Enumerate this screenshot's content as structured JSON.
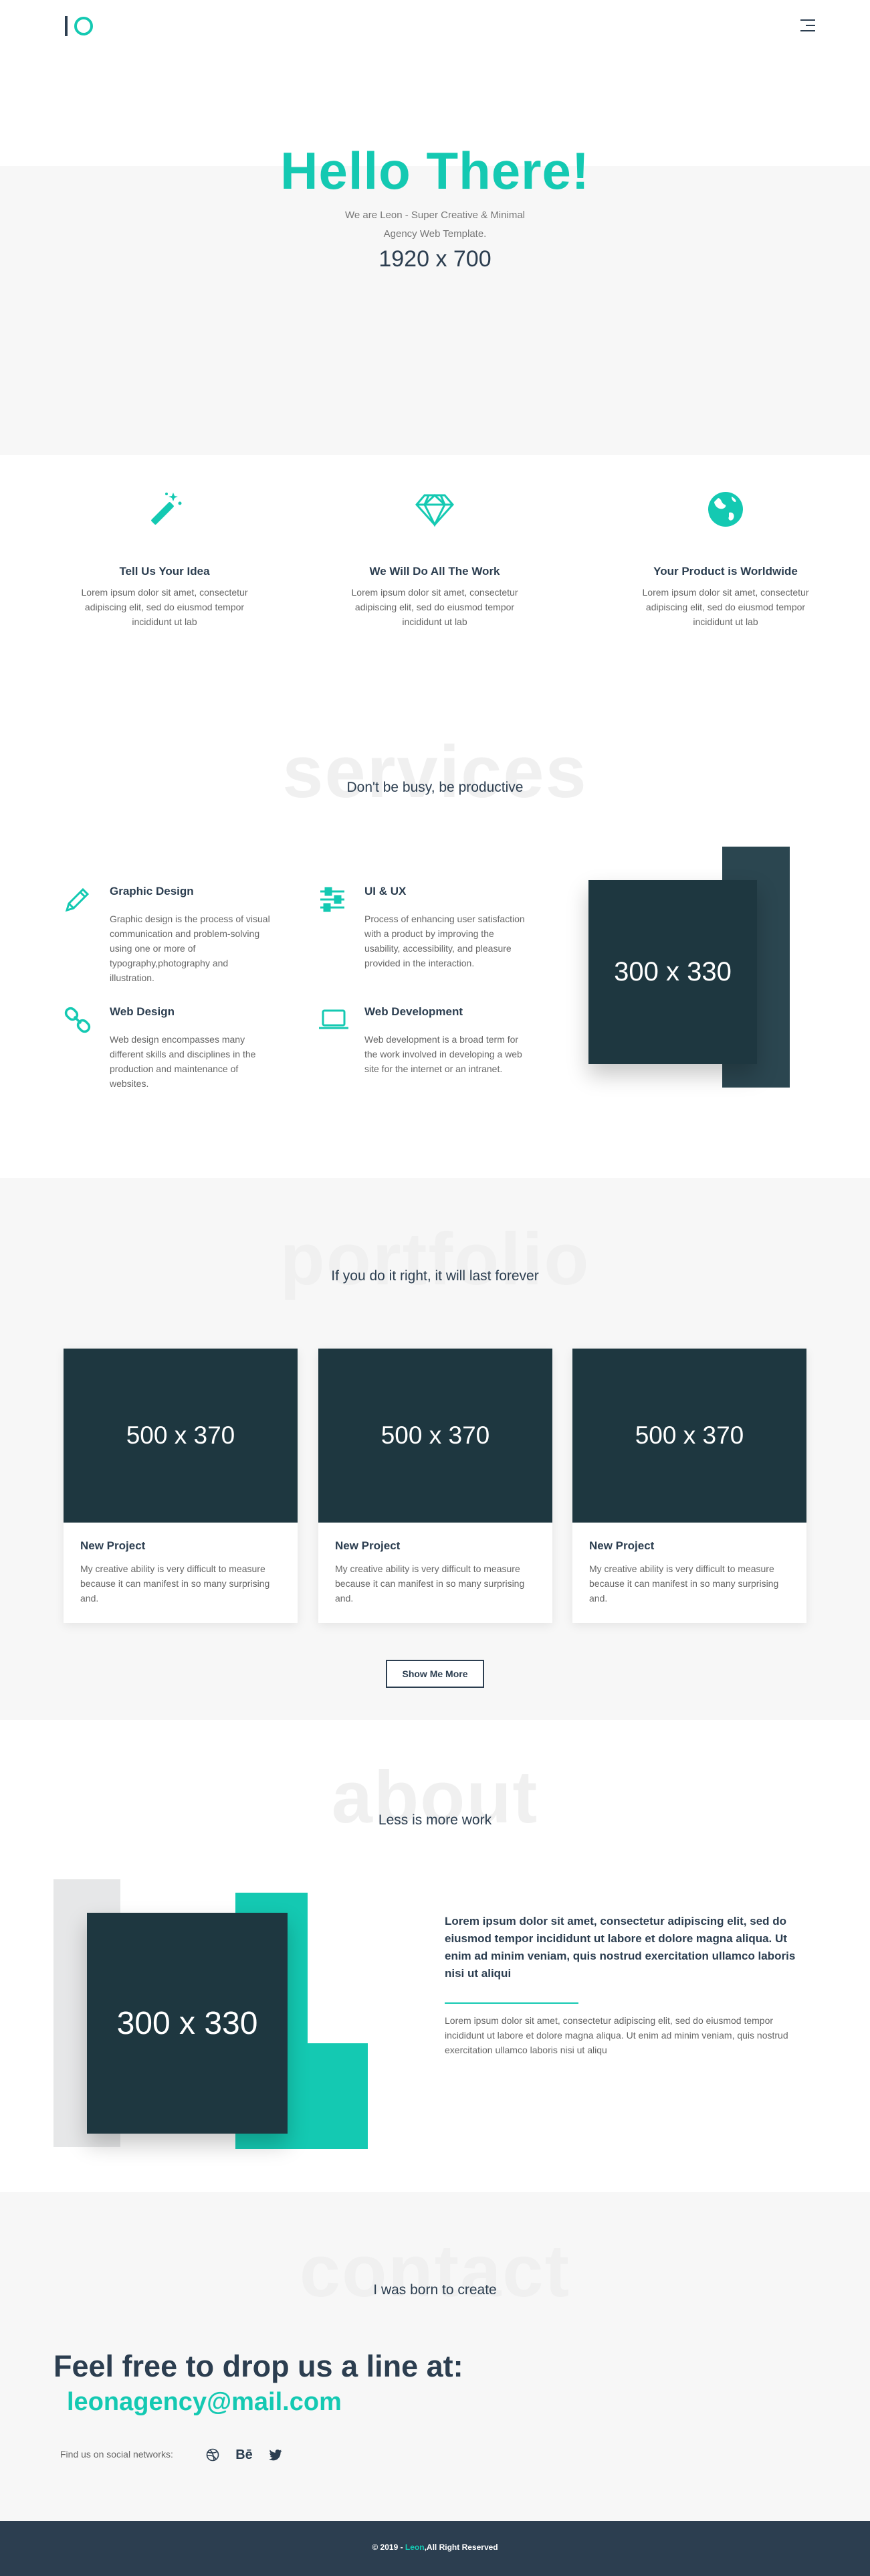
{
  "colors": {
    "accent": "#14c9b2",
    "dark": "#2c3e50",
    "placeholder": "#1e3740",
    "light_bg": "#f7f7f7"
  },
  "header": {
    "logo_icon": "logo-mark",
    "menu_icon": "hamburger-menu-icon"
  },
  "hero": {
    "title": "Hello There!",
    "subtitle_line1": "We are Leon - Super Creative & Minimal",
    "subtitle_line2": "Agency Web Template.",
    "size_label": "1920 x 700"
  },
  "features": [
    {
      "icon": "magic-wand-icon",
      "title": "Tell Us Your Idea",
      "text": "Lorem ipsum dolor sit amet, consectetur adipiscing elit, sed do eiusmod tempor incididunt ut lab"
    },
    {
      "icon": "diamond-icon",
      "title": "We Will Do All The Work",
      "text": "Lorem ipsum dolor sit amet, consectetur adipiscing elit, sed do eiusmod tempor incididunt ut lab"
    },
    {
      "icon": "globe-icon",
      "title": "Your Product is Worldwide",
      "text": "Lorem ipsum dolor sit amet, consectetur adipiscing elit, sed do eiusmod tempor incididunt ut lab"
    }
  ],
  "services": {
    "bg_title": "services",
    "subtitle": "Don't be busy, be productive",
    "items": [
      {
        "icon": "pencil-icon",
        "title": "Graphic Design",
        "text": "Graphic design is the process of visual communication and problem-solving using one or more of typography,photography and illustration."
      },
      {
        "icon": "sliders-icon",
        "title": "UI & UX",
        "text": "Process of enhancing user satisfaction with a product by improving the usability, accessibility, and pleasure provided in the interaction."
      },
      {
        "icon": "link-icon",
        "title": "Web Design",
        "text": "Web design encompasses many different skills and disciplines in the production and maintenance of websites."
      },
      {
        "icon": "laptop-icon",
        "title": "Web Development",
        "text": "Web development is a broad term for the work involved in developing a web site for the internet or an intranet."
      }
    ],
    "image_label": "300 x 330"
  },
  "portfolio": {
    "bg_title": "portfolio",
    "subtitle": "If you do it right, it will last forever",
    "projects": [
      {
        "image_label": "500 x 370",
        "title": "New Project",
        "text": "My creative ability is very difficult to measure because it can manifest in so many surprising and."
      },
      {
        "image_label": "500 x 370",
        "title": "New Project",
        "text": "My creative ability is very difficult to measure because it can manifest in so many surprising and."
      },
      {
        "image_label": "500 x 370",
        "title": "New Project",
        "text": "My creative ability is very difficult to measure because it can manifest in so many surprising and."
      }
    ],
    "show_more": "Show Me More"
  },
  "about": {
    "bg_title": "about",
    "subtitle": "Less is more work",
    "image_label": "300 x 330",
    "bold_text": "Lorem ipsum dolor sit amet, consectetur adipiscing elit, sed do eiusmod tempor incididunt ut labore et dolore magna aliqua. Ut enim ad minim veniam, quis nostrud exercitation ullamco laboris nisi ut aliqui",
    "text": "Lorem ipsum dolor sit amet, consectetur adipiscing elit, sed do eiusmod tempor incididunt ut labore et dolore magna aliqua. Ut enim ad minim veniam, quis nostrud exercitation ullamco laboris nisi ut aliqu"
  },
  "contact": {
    "bg_title": "contact",
    "subtitle": "I was born to create",
    "heading": "Feel free to drop us a line at:",
    "email": "leonagency@mail.com",
    "social_label": "Find us on social networks:",
    "social": [
      {
        "icon": "dribbble-icon"
      },
      {
        "icon": "behance-icon",
        "label": "Bē"
      },
      {
        "icon": "twitter-icon"
      }
    ]
  },
  "footer": {
    "prefix": "© 2019 - ",
    "brand": "Leon",
    "suffix": ",All Right Reserved"
  }
}
